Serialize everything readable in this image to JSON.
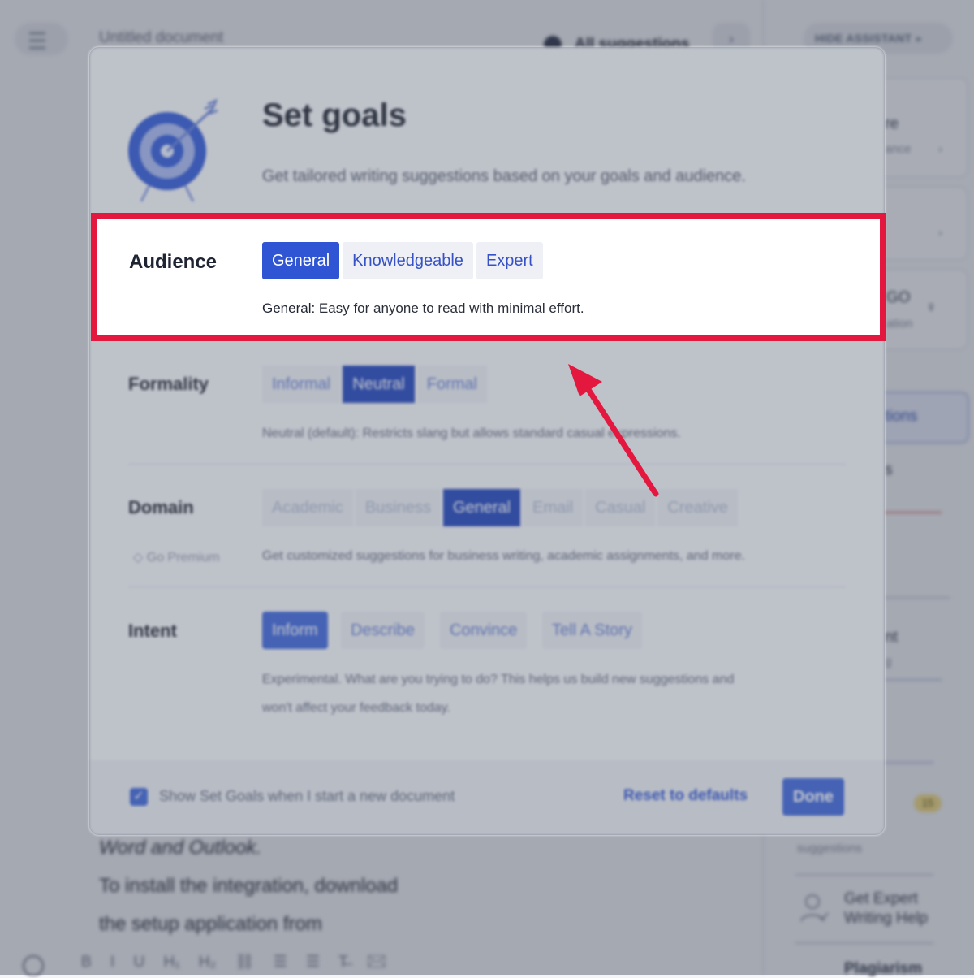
{
  "background": {
    "doc_title": "Untitled document",
    "all_suggestions": "All suggestions",
    "hide_assistant": "HIDE ASSISTANT »",
    "doc_lines": [
      "Word and Outlook.",
      "To install the integration, download",
      "the setup application from"
    ],
    "sidebar": {
      "frag_re": "re",
      "frag_ance": "ance",
      "frag_go": "GO",
      "frag_ation": "ation",
      "frag_tions": "tions",
      "frag_s": "s",
      "frag_nt": "nt",
      "frag_g": "g",
      "badge": "15",
      "suggestions": "suggestions",
      "expert_help_line1": "Get Expert",
      "expert_help_line2": "Writing Help",
      "plagiarism": "Plagiarism"
    },
    "toolbar": "B I U H₁ H₂ ⛓ ☰ ☰ T̶ ✉"
  },
  "modal": {
    "title": "Set goals",
    "subtitle": "Get tailored writing suggestions based on your goals and audience.",
    "audience": {
      "label": "Audience",
      "options": [
        "General",
        "Knowledgeable",
        "Expert"
      ],
      "selected": "General",
      "desc_term": "General:",
      "desc_text": " Easy for anyone to read with minimal effort."
    },
    "formality": {
      "label": "Formality",
      "options": [
        "Informal",
        "Neutral",
        "Formal"
      ],
      "selected": "Neutral",
      "desc": "Neutral (default): Restricts slang but allows standard casual expressions."
    },
    "domain": {
      "label": "Domain",
      "options": [
        "Academic",
        "Business",
        "General",
        "Email",
        "Casual",
        "Creative"
      ],
      "selected": "General",
      "premium": "Go Premium",
      "desc": "Get customized suggestions for business writing, academic assignments, and more."
    },
    "intent": {
      "label": "Intent",
      "options": [
        "Inform",
        "Describe",
        "Convince",
        "Tell A Story"
      ],
      "selected": "Inform",
      "desc_line1": "Experimental. What are you trying to do? This helps us build new suggestions and",
      "desc_line2": "won't affect your feedback today."
    },
    "footer": {
      "show_checkbox_label": "Show Set Goals when I start a new document",
      "checked": true,
      "reset": "Reset to defaults",
      "done": "Done"
    }
  },
  "colors": {
    "accent": "#2f55d4",
    "highlight_border": "#e4173f",
    "arrow": "#e4173f"
  }
}
